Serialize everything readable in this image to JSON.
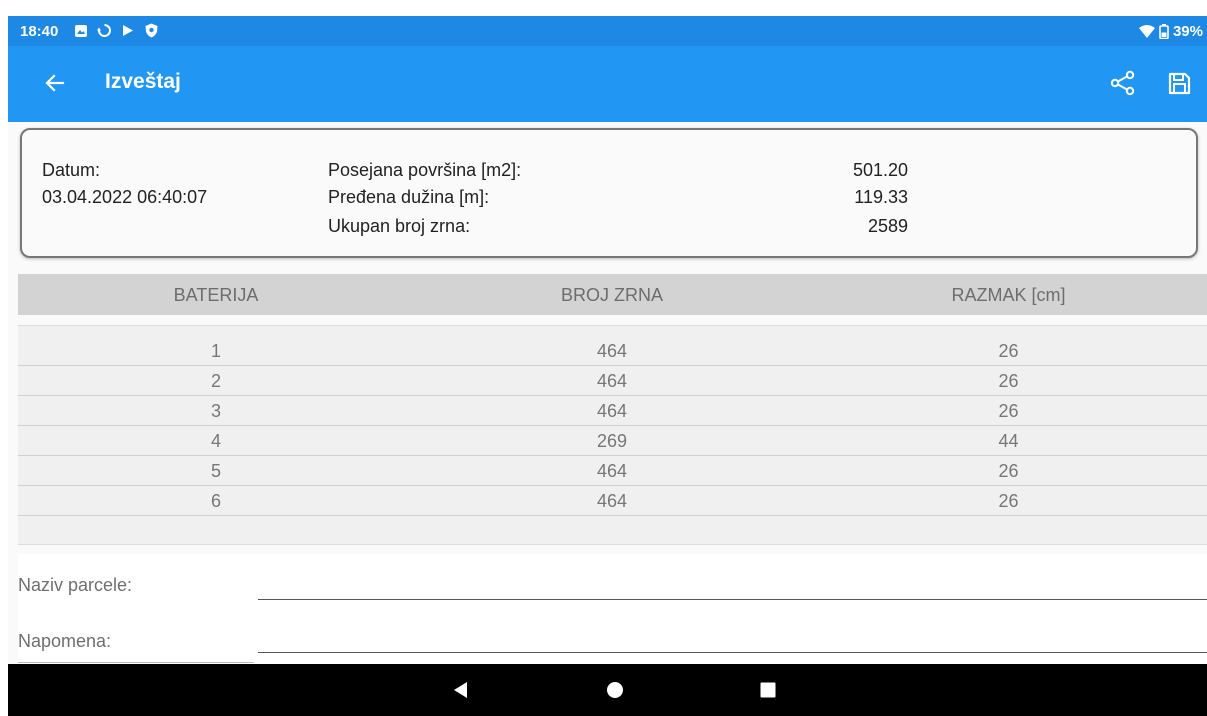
{
  "status_bar": {
    "time": "18:40",
    "battery": "39%"
  },
  "app_bar": {
    "title": "Izveštaj"
  },
  "summary": {
    "date_label": "Datum:",
    "date_value": "03.04.2022 06:40:07",
    "area_label": "Posejana površina [m2]:",
    "area_value": "501.20",
    "length_label": "Pređena dužina [m]:",
    "length_value": "119.33",
    "seeds_label": "Ukupan broj zrna:",
    "seeds_value": "2589"
  },
  "table": {
    "headers": [
      "BATERIJA",
      "BROJ ZRNA",
      "RAZMAK [cm]"
    ],
    "rows": [
      [
        "1",
        "464",
        "26"
      ],
      [
        "2",
        "464",
        "26"
      ],
      [
        "3",
        "464",
        "26"
      ],
      [
        "4",
        "269",
        "44"
      ],
      [
        "5",
        "464",
        "26"
      ],
      [
        "6",
        "464",
        "26"
      ]
    ]
  },
  "form": {
    "parcel_label": "Naziv parcele:",
    "parcel_value": "",
    "note_label": "Napomena:",
    "note_value": ""
  },
  "colors": {
    "status_bar": "#1e88e5",
    "app_bar": "#2196f3",
    "table_header": "#d3d3d3",
    "nav_bar": "#000000"
  },
  "icons": {
    "back": "arrow-back-icon",
    "share": "share-icon",
    "save": "floppy-disk-icon",
    "nav_back": "triangle-back-icon",
    "nav_home": "circle-home-icon",
    "nav_recents": "square-recents-icon"
  }
}
